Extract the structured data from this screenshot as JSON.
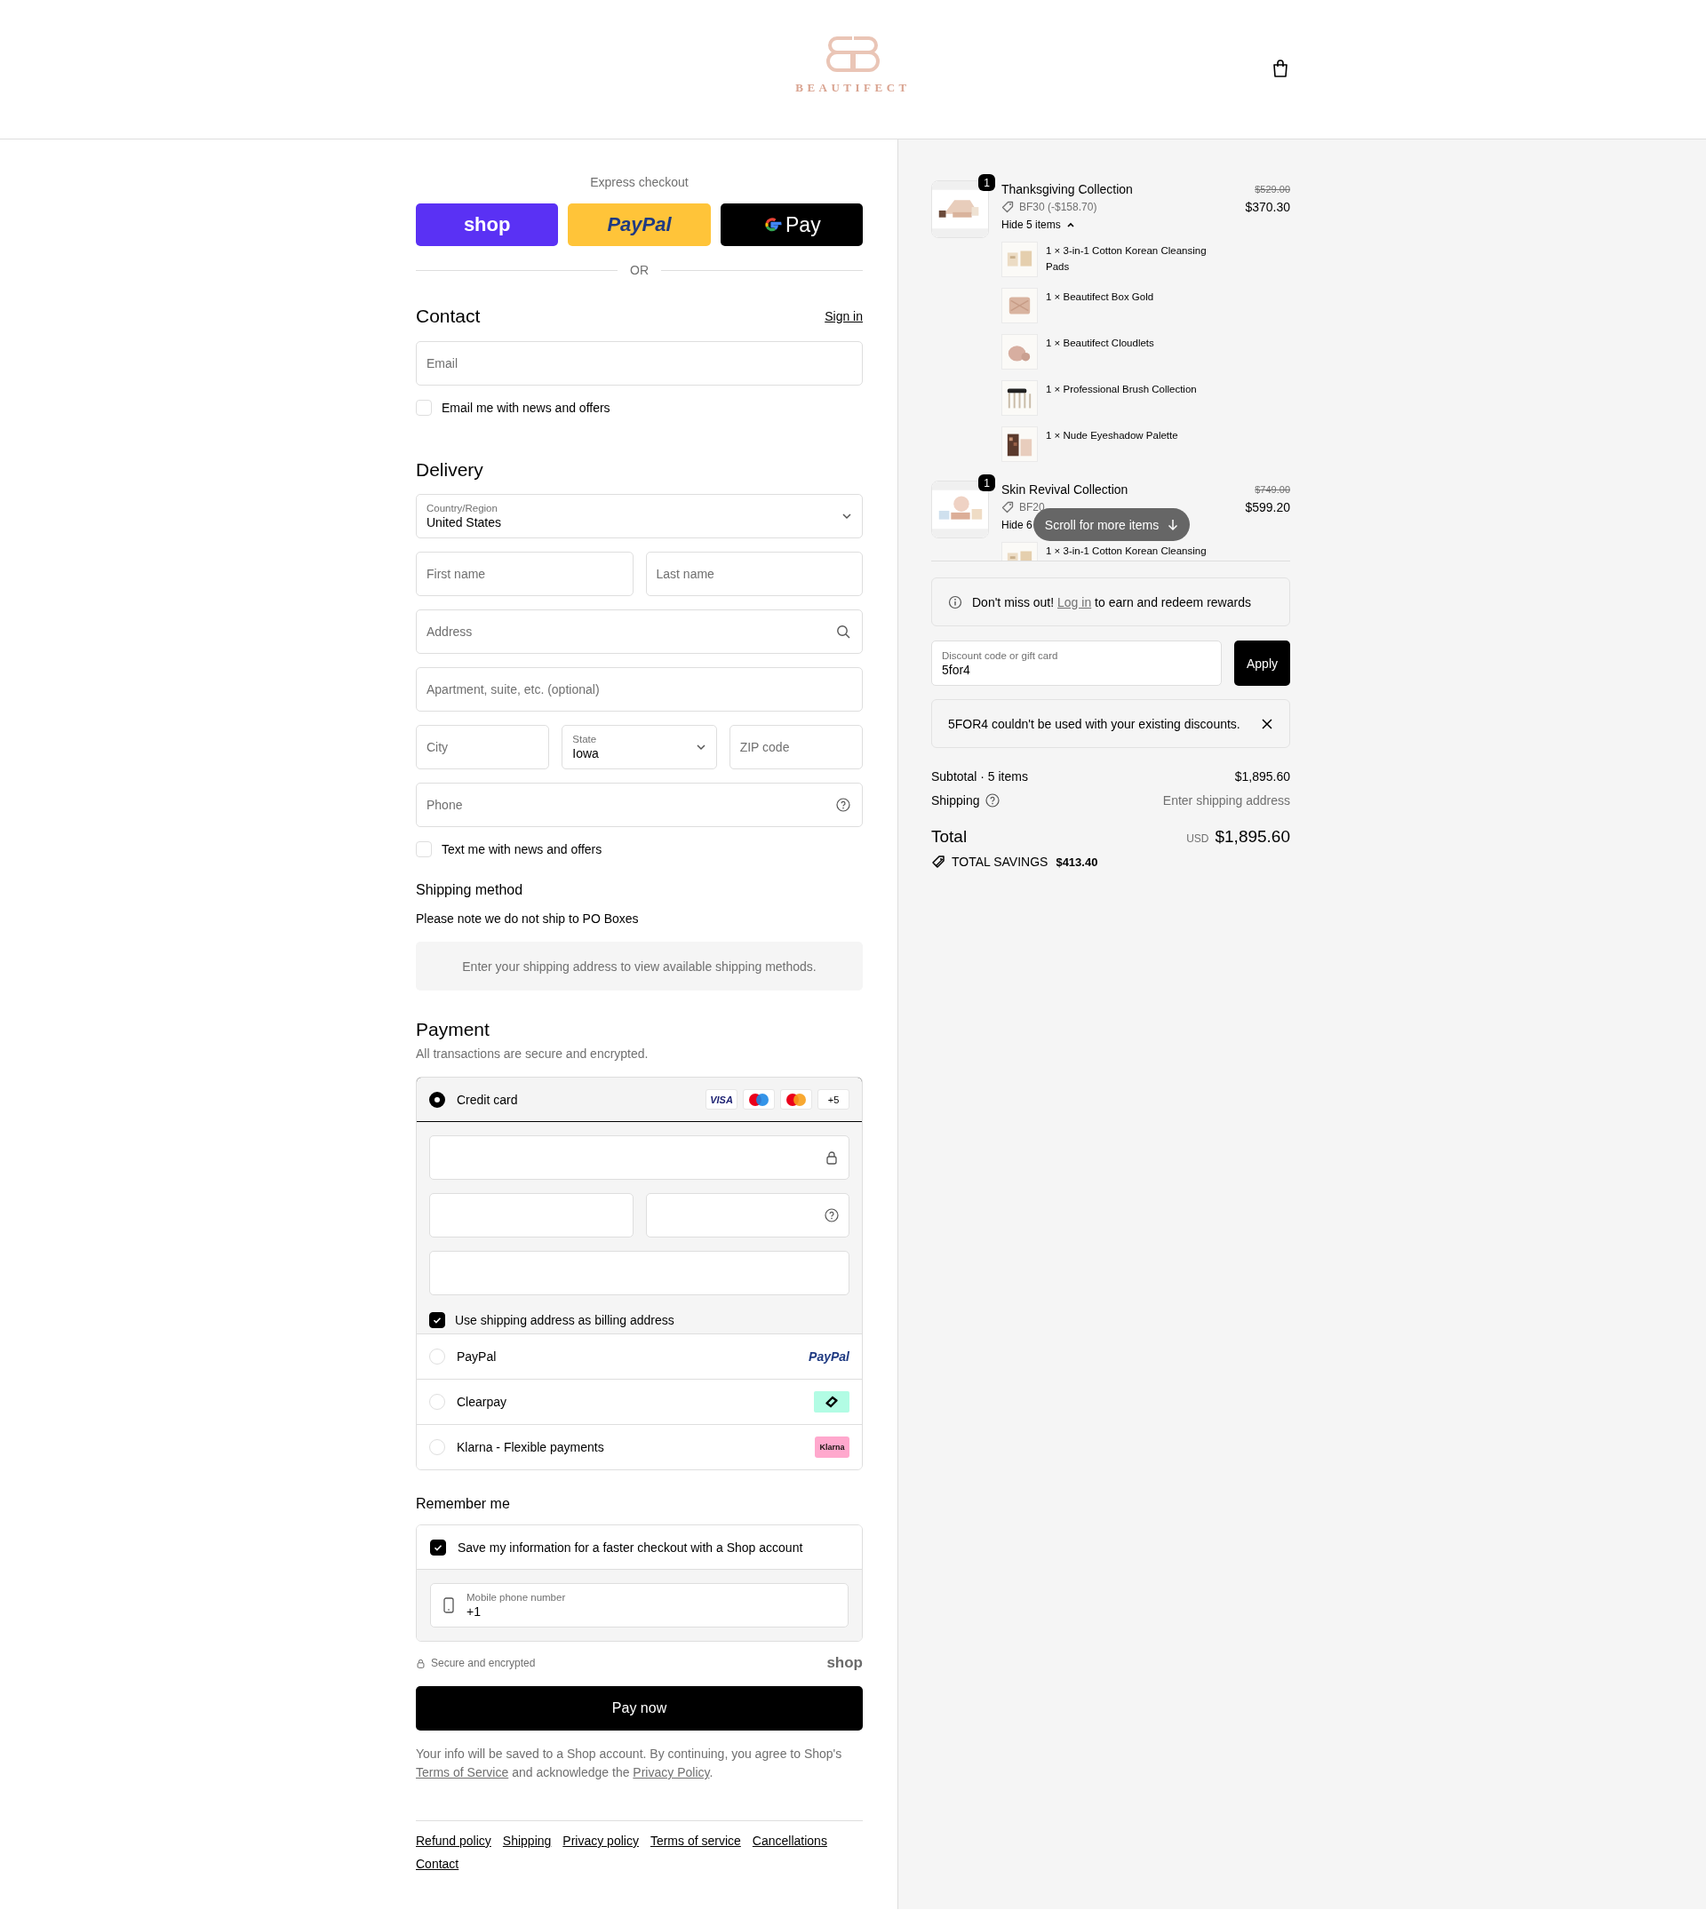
{
  "header": {
    "logo_text": "BEAUTIFECT"
  },
  "express": {
    "title": "Express checkout",
    "buttons": [
      {
        "kind": "shop",
        "label": "shop"
      },
      {
        "kind": "paypal",
        "label": "PayPal"
      },
      {
        "kind": "gpay",
        "label": "Pay"
      }
    ],
    "divider": "OR"
  },
  "contact": {
    "title": "Contact",
    "sign_in": "Sign in",
    "email": {
      "placeholder": "Email"
    },
    "newsletter": {
      "label": "Email me with news and offers",
      "checked": false
    }
  },
  "delivery": {
    "title": "Delivery",
    "rows": [
      [
        {
          "kind": "select",
          "label": "Country/Region",
          "value": "United States"
        }
      ],
      [
        {
          "kind": "input",
          "placeholder": "First name"
        },
        {
          "kind": "input",
          "placeholder": "Last name"
        }
      ],
      [
        {
          "kind": "search",
          "placeholder": "Address"
        }
      ],
      [
        {
          "kind": "input",
          "placeholder": "Apartment, suite, etc. (optional)"
        }
      ],
      [
        {
          "kind": "input",
          "placeholder": "City"
        },
        {
          "kind": "select",
          "label": "State",
          "value": "Iowa"
        },
        {
          "kind": "input",
          "placeholder": "ZIP code"
        }
      ],
      [
        {
          "kind": "help",
          "placeholder": "Phone"
        }
      ]
    ],
    "text_offers": {
      "label": "Text me with news and offers",
      "checked": false
    }
  },
  "shipping_method": {
    "title": "Shipping method",
    "note": "Please note we do not ship to PO Boxes",
    "empty_message": "Enter your shipping address to view available shipping methods."
  },
  "payment": {
    "title": "Payment",
    "subtitle": "All transactions are secure and encrypted.",
    "methods": [
      {
        "kind": "card",
        "label": "Credit card",
        "selected": true,
        "brands": [
          {
            "kind": "visa",
            "label": "VISA"
          },
          {
            "kind": "maestro"
          },
          {
            "kind": "mastercard"
          },
          {
            "kind": "more",
            "label": "+5"
          }
        ],
        "billing_same": {
          "label": "Use shipping address as billing address",
          "checked": true
        }
      },
      {
        "kind": "paypal",
        "label": "PayPal",
        "selected": false,
        "logo_text": "PayPal"
      },
      {
        "kind": "clearpay",
        "label": "Clearpay",
        "selected": false
      },
      {
        "kind": "klarna",
        "label": "Klarna - Flexible payments",
        "selected": false,
        "logo_text": "Klarna"
      }
    ]
  },
  "remember": {
    "title": "Remember me",
    "save": {
      "label": "Save my information for a faster checkout with a Shop account",
      "checked": true
    },
    "phone": {
      "label": "Mobile phone number",
      "value": "+1"
    }
  },
  "secure_note": "Secure and encrypted",
  "shop_logo": "shop",
  "pay_button": "Pay now",
  "disclaimer": [
    {
      "kind": "text",
      "text": "Your info will be saved to a Shop account. By continuing, you agree to Shop's "
    },
    {
      "kind": "link",
      "text": "Terms of Service"
    },
    {
      "kind": "text",
      "text": " and acknowledge the "
    },
    {
      "kind": "link",
      "text": "Privacy Policy"
    },
    {
      "kind": "text",
      "text": "."
    }
  ],
  "footer_links": [
    "Refund policy",
    "Shipping",
    "Privacy policy",
    "Terms of service",
    "Cancellations",
    "Contact"
  ],
  "summary": {
    "items": [
      {
        "name": "Thanksgiving Collection",
        "quantity": "1",
        "discount": "BF30 (-$158.70)",
        "toggle": "Hide 5 items",
        "expanded": true,
        "chevron_shown": true,
        "original_price": "$529.00",
        "price": "$370.30",
        "children": [
          {
            "label": "1 × 3-in-1 Cotton Korean Cleansing Pads"
          },
          {
            "label": "1 × Beautifect Box Gold"
          },
          {
            "label": "1 × Beautifect Cloudlets"
          },
          {
            "label": "1 × Professional Brush Collection"
          },
          {
            "label": "1 × Nude Eyeshadow Palette"
          }
        ]
      },
      {
        "name": "Skin Revival Collection",
        "quantity": "1",
        "discount": "BF20",
        "toggle": "Hide 6",
        "expanded": true,
        "chevron_shown": false,
        "original_price": "$749.00",
        "price": "$599.20",
        "children": [
          {
            "label": "1 × 3-in-1 Cotton Korean Cleansing"
          }
        ]
      }
    ],
    "scroll_hint": "Scroll for more items",
    "rewards": [
      {
        "kind": "text",
        "text": "Don't miss out! "
      },
      {
        "kind": "link",
        "text": "Log in"
      },
      {
        "kind": "text",
        "text": " to earn and redeem rewards"
      }
    ],
    "discount": {
      "label": "Discount code or gift card",
      "value": "5for4",
      "button": "Apply"
    },
    "error": "5FOR4 couldn't be used with your existing discounts.",
    "subtotal_label": "Subtotal · 5 items",
    "subtotal": "$1,895.60",
    "shipping_label": "Shipping",
    "shipping": "Enter shipping address",
    "total_label": "Total",
    "currency": "USD",
    "total": "$1,895.60",
    "savings_label": "TOTAL SAVINGS",
    "savings": "$413.40"
  }
}
